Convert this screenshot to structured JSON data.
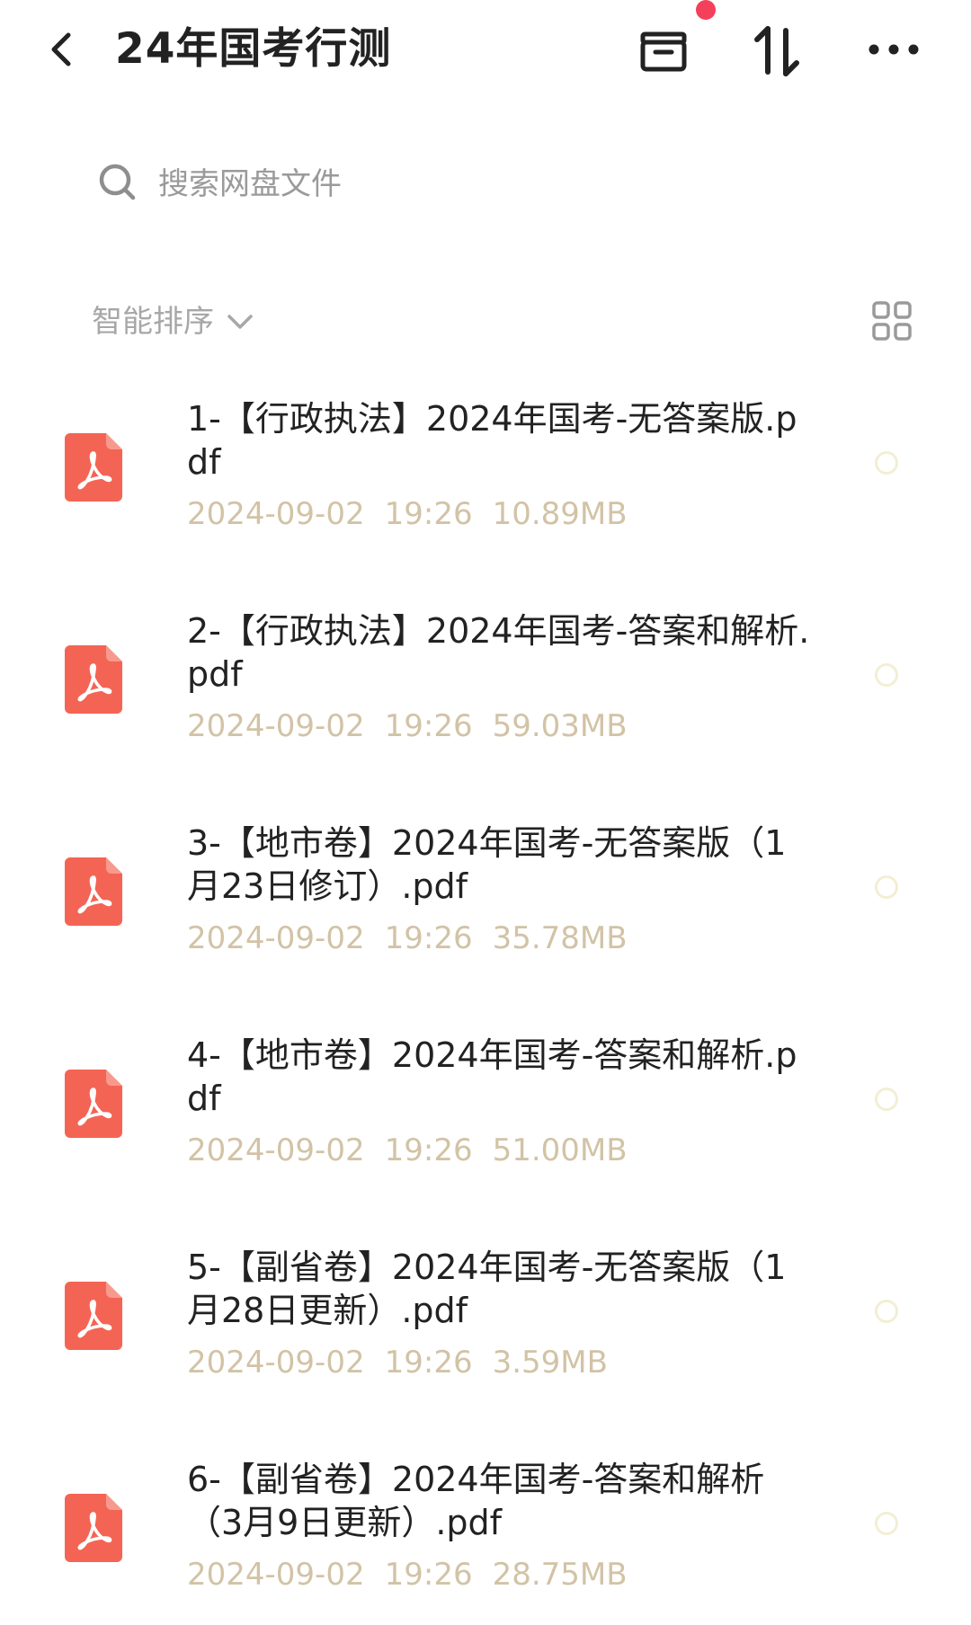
{
  "header": {
    "title": "24年国考行测",
    "back_icon": "chevron-left-icon",
    "archive_icon": "archive-box-icon",
    "sort_icon": "sort-arrows-icon",
    "more_icon": "more-dots-icon",
    "notification_dot_color": "#f4405a"
  },
  "search": {
    "placeholder": "搜索网盘文件",
    "value": ""
  },
  "sort": {
    "label": "智能排序",
    "view_toggle_icon": "grid-view-icon"
  },
  "colors": {
    "pdf_icon_bg": "#f46454",
    "meta_text": "#d2c3a6",
    "title_text": "#222222"
  },
  "files": [
    {
      "name": "1-【行政执法】2024年国考-无答案版.pdf",
      "date": "2024-09-02",
      "time": "19:26",
      "size": "10.89MB",
      "icon": "pdf-file-icon"
    },
    {
      "name": "2-【行政执法】2024年国考-答案和解析.pdf",
      "date": "2024-09-02",
      "time": "19:26",
      "size": "59.03MB",
      "icon": "pdf-file-icon"
    },
    {
      "name": "3-【地市卷】2024年国考-无答案版（1月23日修订）.pdf",
      "date": "2024-09-02",
      "time": "19:26",
      "size": "35.78MB",
      "icon": "pdf-file-icon"
    },
    {
      "name": "4-【地市卷】2024年国考-答案和解析.pdf",
      "date": "2024-09-02",
      "time": "19:26",
      "size": "51.00MB",
      "icon": "pdf-file-icon"
    },
    {
      "name": "5-【副省卷】2024年国考-无答案版（1月28日更新）.pdf",
      "date": "2024-09-02",
      "time": "19:26",
      "size": "3.59MB",
      "icon": "pdf-file-icon"
    },
    {
      "name": "6-【副省卷】2024年国考-答案和解析（3月9日更新）.pdf",
      "date": "2024-09-02",
      "time": "19:26",
      "size": "28.75MB",
      "icon": "pdf-file-icon"
    }
  ]
}
